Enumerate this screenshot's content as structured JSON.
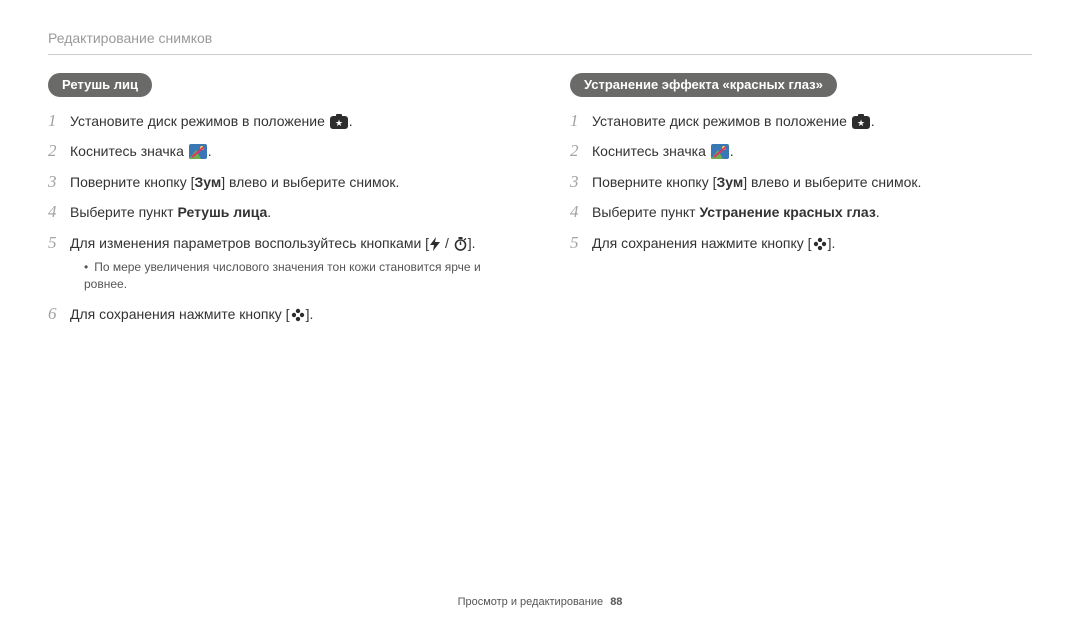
{
  "chapter_title": "Редактирование снимков",
  "footer": {
    "label": "Просмотр и редактирование",
    "page": "88"
  },
  "icons": {
    "mode_star": "★",
    "edit_brush": "✎",
    "flash": "⚡",
    "timer": "⏱",
    "flower": "❀"
  },
  "left": {
    "title": "Ретушь лиц",
    "steps": [
      {
        "n": "1",
        "pre": "Установите диск режимов в положение ",
        "icon": "mode_star",
        "post": "."
      },
      {
        "n": "2",
        "pre": "Коснитесь значка ",
        "icon": "edit_brush",
        "post": "."
      },
      {
        "n": "3",
        "pre": "Поверните кнопку [",
        "bold1": "Зум",
        "mid": "] влево и выберите снимок."
      },
      {
        "n": "4",
        "pre": "Выберите пункт ",
        "bold1": "Ретушь лица",
        "mid": "."
      },
      {
        "n": "5",
        "pre": "Для изменения параметров воспользуйтесь кнопками [",
        "icon": "flash_timer",
        "post": "].",
        "sub": [
          "По мере увеличения числового значения тон кожи становится ярче и ровнее."
        ]
      },
      {
        "n": "6",
        "pre": "Для сохранения нажмите кнопку [",
        "icon": "flower",
        "post": "]."
      }
    ]
  },
  "right": {
    "title": "Устранение эффекта «красных глаз»",
    "steps": [
      {
        "n": "1",
        "pre": "Установите диск режимов в положение ",
        "icon": "mode_star",
        "post": "."
      },
      {
        "n": "2",
        "pre": "Коснитесь значка ",
        "icon": "edit_brush",
        "post": "."
      },
      {
        "n": "3",
        "pre": "Поверните кнопку [",
        "bold1": "Зум",
        "mid": "] влево и выберите снимок."
      },
      {
        "n": "4",
        "pre": "Выберите пункт ",
        "bold1": "Устранение красных глаз",
        "mid": "."
      },
      {
        "n": "5",
        "pre": "Для сохранения нажмите кнопку [",
        "icon": "flower",
        "post": "]."
      }
    ]
  }
}
